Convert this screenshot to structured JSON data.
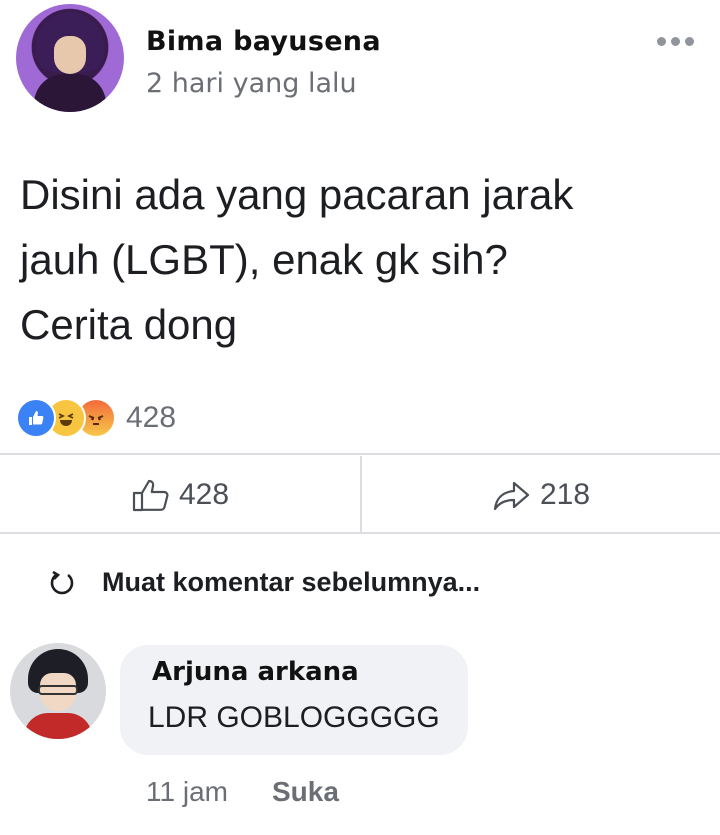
{
  "post": {
    "author": "Bima bayusena",
    "time": "2 hari yang lalu",
    "text_lines": [
      "Disini ada yang pacaran jarak",
      "jauh (LGBT), enak gk sih?",
      "Cerita dong"
    ],
    "reactions": {
      "icons": [
        "like-icon",
        "haha-icon",
        "angry-icon"
      ],
      "count": "428"
    }
  },
  "actions": {
    "like_count": "428",
    "share_count": "218"
  },
  "comments": {
    "load_previous": "Muat komentar sebelumnya...",
    "items": [
      {
        "author": "Arjuna arkana",
        "text": "LDR GOBLOGGGGG",
        "time": "11 jam",
        "like_label": "Suka"
      }
    ]
  },
  "colors": {
    "accent": "#3b82f6",
    "muted": "#6b6f75",
    "bubble": "#f0f2f5"
  }
}
